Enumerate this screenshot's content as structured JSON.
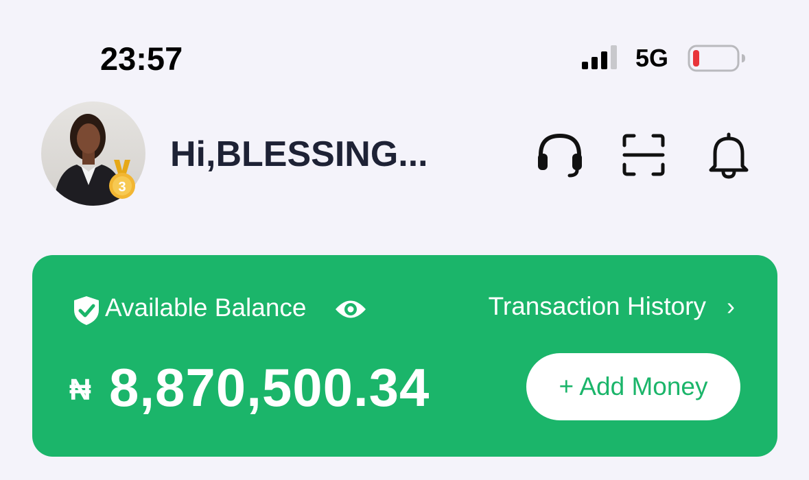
{
  "status_bar": {
    "time": "23:57",
    "network": "5G",
    "battery_color": "#e8343a"
  },
  "header": {
    "greeting": "Hi,BLESSING...",
    "badge_level": "3",
    "icons": [
      "headset-icon",
      "scan-icon",
      "bell-icon"
    ]
  },
  "balance_card": {
    "label": "Available Balance",
    "history_link": "Transaction History",
    "history_chevron": "›",
    "currency_symbol": "₦",
    "amount": "8,870,500.34",
    "add_money_label": "+ Add Money",
    "accent_color": "#1bb56a"
  }
}
